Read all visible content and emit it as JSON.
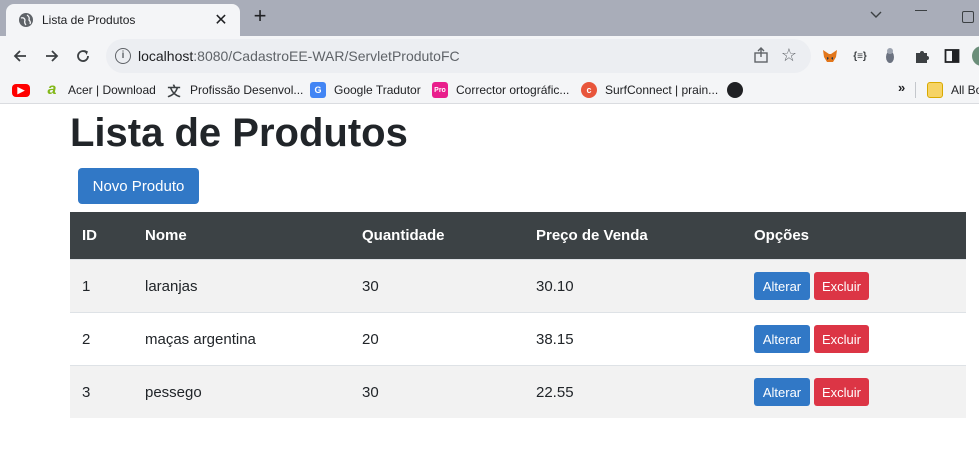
{
  "browser": {
    "tab_title": "Lista de Produtos",
    "tab_close": "✕",
    "new_tab": "+",
    "url_host": "localhost",
    "url_path": ":8080/CadastroEE-WAR/ServletProdutoFC",
    "bookmarks": [
      {
        "label": "Acer | Download",
        "icon": "acer-icon",
        "color": "#83b81a"
      },
      {
        "label": "Profissão Desenvol...",
        "icon": "translate-icon",
        "color": "#5f6368"
      },
      {
        "label": "Google Tradutor",
        "icon": "google-translate-icon",
        "color": "#4285f4"
      },
      {
        "label": "Corrector ortográfic...",
        "icon": "spellcheck-icon",
        "color": "#e91e8c"
      },
      {
        "label": "SurfConnect | prain...",
        "icon": "surfconnect-icon",
        "color": "#e8553b"
      }
    ],
    "bookmarks_more": "»",
    "all_bookmarks": "All Bo"
  },
  "page": {
    "title": "Lista de Produtos",
    "new_button": "Novo Produto",
    "columns": [
      "ID",
      "Nome",
      "Quantidade",
      "Preço de Venda",
      "Opções"
    ],
    "rows": [
      {
        "id": "1",
        "nome": "laranjas",
        "quantidade": "30",
        "preco": "30.10"
      },
      {
        "id": "2",
        "nome": "maças argentina",
        "quantidade": "20",
        "preco": "38.15"
      },
      {
        "id": "3",
        "nome": "pessego",
        "quantidade": "30",
        "preco": "22.55"
      }
    ],
    "edit_label": "Alterar",
    "delete_label": "Excluir"
  },
  "colors": {
    "primary": "#3178c6",
    "danger": "#dc3545",
    "table_header": "#3c4245"
  }
}
